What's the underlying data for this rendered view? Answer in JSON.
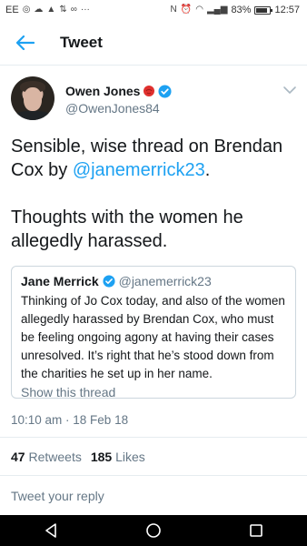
{
  "status_bar": {
    "carrier": "EE",
    "battery": "83%",
    "battery_level": 0.83,
    "time": "12:57"
  },
  "header": {
    "title": "Tweet",
    "back_icon": "back-arrow-icon"
  },
  "tweet": {
    "author_name": "Owen Jones",
    "author_handle": "@OwenJones84",
    "text_before_mention": "Sensible, wise thread on Brendan Cox by ",
    "mention": "@janemerrick23",
    "text_after_mention": ".",
    "text_second_paragraph": "Thoughts with the women he allegedly harassed.",
    "timestamp": "10:10 am · 18 Feb 18",
    "retweets_count": "47",
    "retweets_label": "Retweets",
    "likes_count": "185",
    "likes_label": "Likes"
  },
  "quoted_tweet": {
    "author_name": "Jane Merrick",
    "author_handle": "@janemerrick23",
    "text": "Thinking of Jo Cox today, and also of the women allegedly harassed by Brendan Cox, who must be feeling ongoing agony at having their cases unresolved. It’s right that he’s stood down from the charities he set up in her name.",
    "show_thread": "Show this thread"
  },
  "reply_box": {
    "placeholder": "Tweet your reply"
  },
  "colors": {
    "link": "#1da1f2",
    "secondary_text": "#657786",
    "border": "#ccd6dd"
  }
}
